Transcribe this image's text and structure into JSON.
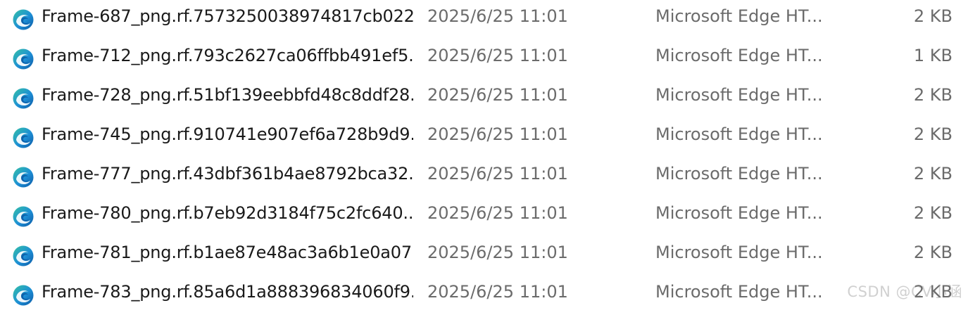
{
  "files": [
    {
      "name": "Frame-687_png.rf.7573250038974817cb022...",
      "date": "2025/6/25 11:01",
      "type": "Microsoft Edge HT...",
      "size": "2 KB",
      "icon": "edge-icon"
    },
    {
      "name": "Frame-712_png.rf.793c2627ca06ffbb491ef5...",
      "date": "2025/6/25 11:01",
      "type": "Microsoft Edge HT...",
      "size": "1 KB",
      "icon": "edge-icon"
    },
    {
      "name": "Frame-728_png.rf.51bf139eebbfd48c8ddf28...",
      "date": "2025/6/25 11:01",
      "type": "Microsoft Edge HT...",
      "size": "2 KB",
      "icon": "edge-icon"
    },
    {
      "name": "Frame-745_png.rf.910741e907ef6a728b9d9...",
      "date": "2025/6/25 11:01",
      "type": "Microsoft Edge HT...",
      "size": "2 KB",
      "icon": "edge-icon"
    },
    {
      "name": "Frame-777_png.rf.43dbf361b4ae8792bca32...",
      "date": "2025/6/25 11:01",
      "type": "Microsoft Edge HT...",
      "size": "2 KB",
      "icon": "edge-icon"
    },
    {
      "name": "Frame-780_png.rf.b7eb92d3184f75c2fc640...",
      "date": "2025/6/25 11:01",
      "type": "Microsoft Edge HT...",
      "size": "2 KB",
      "icon": "edge-icon"
    },
    {
      "name": "Frame-781_png.rf.b1ae87e48ac3a6b1e0a07...",
      "date": "2025/6/25 11:01",
      "type": "Microsoft Edge HT...",
      "size": "2 KB",
      "icon": "edge-icon"
    },
    {
      "name": "Frame-783_png.rf.85a6d1a888396834060f9...",
      "date": "2025/6/25 11:01",
      "type": "Microsoft Edge HT...",
      "size": "2 KB",
      "icon": "edge-icon"
    }
  ],
  "watermark": "CSDN @CV小涵",
  "colors": {
    "name_text": "#1a1a1a",
    "secondary_text": "#6b6b6b",
    "edge_blue": "#0c59a4",
    "edge_teal": "#35c1a5"
  }
}
